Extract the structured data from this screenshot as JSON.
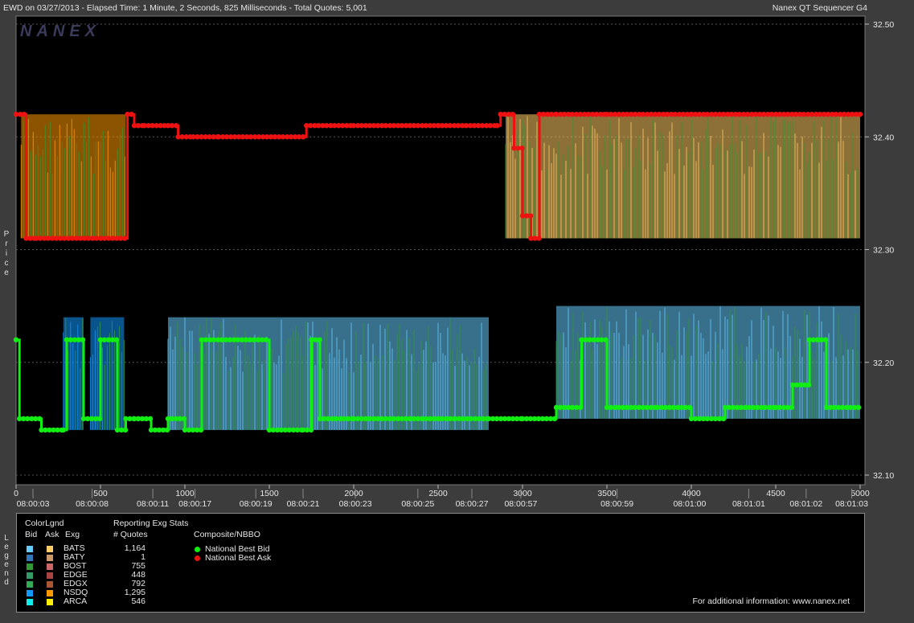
{
  "header": {
    "left": "EWD on 03/27/2013  -  Elapsed Time: 1 Minute, 2 Seconds, 825 Milliseconds  -  Total Quotes: 5,001",
    "right": "Nanex QT Sequencer G4"
  },
  "watermark": "NANEX",
  "side_labels": {
    "price": "Price",
    "legend": "Legend"
  },
  "colors": {
    "background": "#000000",
    "nbbo_bid": "#11ee11",
    "nbbo_ask": "#ee1111",
    "bats_bid": "#66ccff",
    "bats_ask": "#ffcc66",
    "nsdq_bid": "#1199ff",
    "nsdq_ask": "#ff9900",
    "arca_bid": "#11eeee",
    "arca_ask": "#ffee00",
    "boost_bid": "#339933",
    "boost_ask": "#cc6666"
  },
  "chart_data": {
    "type": "line",
    "title": "EWD on 03/27/2013",
    "xlabel": "",
    "ylabel": "Price",
    "xlim": [
      0,
      5000
    ],
    "ylim": [
      32.09,
      32.5
    ],
    "yticks": [
      "32.50",
      "32.40",
      "32.30",
      "32.20",
      "32.10"
    ],
    "xticks": [
      {
        "value": 0,
        "label": "0"
      },
      {
        "value": 500,
        "label": "500"
      },
      {
        "value": 1000,
        "label": "1000"
      },
      {
        "value": 1500,
        "label": "1500"
      },
      {
        "value": 2000,
        "label": "2000"
      },
      {
        "value": 2500,
        "label": "2500"
      },
      {
        "value": 3000,
        "label": "3000"
      },
      {
        "value": 3500,
        "label": "3500"
      },
      {
        "value": 4000,
        "label": "4000"
      },
      {
        "value": 4500,
        "label": "4500"
      },
      {
        "value": 5000,
        "label": "5000"
      }
    ],
    "time_labels": [
      {
        "value": 100,
        "label": "08:00:03"
      },
      {
        "value": 450,
        "label": "08:00:08"
      },
      {
        "value": 810,
        "label": "08:00:11"
      },
      {
        "value": 1060,
        "label": "08:00:17"
      },
      {
        "value": 1420,
        "label": "08:00:19"
      },
      {
        "value": 1700,
        "label": "08:00:21"
      },
      {
        "value": 2010,
        "label": "08:00:23"
      },
      {
        "value": 2380,
        "label": "08:00:25"
      },
      {
        "value": 2700,
        "label": "08:00:27"
      },
      {
        "value": 2990,
        "label": "08:00:57"
      },
      {
        "value": 3560,
        "label": "08:00:59"
      },
      {
        "value": 3990,
        "label": "08:01:00"
      },
      {
        "value": 4340,
        "label": "08:01:01"
      },
      {
        "value": 4680,
        "label": "08:01:02"
      },
      {
        "value": 4950,
        "label": "08:01:03"
      }
    ],
    "series": [
      {
        "name": "National Best Ask",
        "x": [
          0,
          60,
          120,
          660,
          700,
          760,
          900,
          960,
          1050,
          1200,
          1700,
          1720,
          2000,
          2500,
          2850,
          2870,
          2950,
          3000,
          3050,
          3100,
          3200,
          3500,
          4000,
          4500,
          5000
        ],
        "y": [
          32.42,
          32.31,
          32.31,
          32.42,
          32.41,
          32.41,
          32.41,
          32.4,
          32.4,
          32.4,
          32.4,
          32.41,
          32.41,
          32.41,
          32.41,
          32.42,
          32.39,
          32.33,
          32.31,
          32.42,
          32.42,
          32.42,
          32.42,
          32.42,
          32.42
        ]
      },
      {
        "name": "National Best Bid",
        "x": [
          0,
          20,
          150,
          280,
          300,
          400,
          500,
          600,
          650,
          700,
          800,
          900,
          1000,
          1100,
          1500,
          1700,
          1750,
          1800,
          2000,
          2500,
          2600,
          2800,
          3000,
          3200,
          3350,
          3500,
          3800,
          4000,
          4200,
          4500,
          4600,
          4700,
          4800,
          5000
        ],
        "y": [
          32.22,
          32.15,
          32.14,
          32.14,
          32.22,
          32.15,
          32.22,
          32.14,
          32.15,
          32.15,
          32.14,
          32.15,
          32.14,
          32.22,
          32.14,
          32.14,
          32.22,
          32.15,
          32.15,
          32.15,
          32.15,
          32.15,
          32.15,
          32.16,
          32.22,
          32.16,
          32.16,
          32.15,
          32.16,
          32.16,
          32.18,
          32.22,
          32.16,
          32.16
        ]
      }
    ],
    "exchange_regions": [
      {
        "exchange": "NSDQ",
        "side": "ask",
        "x0": 30,
        "x1": 650,
        "low": 32.31,
        "high": 32.42
      },
      {
        "exchange": "NSDQ",
        "side": "bid",
        "x0": 280,
        "x1": 400,
        "low": 32.14,
        "high": 32.24
      },
      {
        "exchange": "NSDQ",
        "side": "bid",
        "x0": 440,
        "x1": 640,
        "low": 32.14,
        "high": 32.24
      },
      {
        "exchange": "BATS",
        "side": "ask",
        "x0": 2900,
        "x1": 5000,
        "low": 32.31,
        "high": 32.42
      },
      {
        "exchange": "BATS",
        "side": "bid",
        "x0": 900,
        "x1": 2800,
        "low": 32.14,
        "high": 32.24
      },
      {
        "exchange": "BATS",
        "side": "bid",
        "x0": 3200,
        "x1": 5000,
        "low": 32.15,
        "high": 32.25
      }
    ]
  },
  "legend": {
    "colorlgnd": "ColorLgnd",
    "col_bid": "Bid",
    "col_ask": "Ask",
    "col_exg": "Exg",
    "reporting": "Reporting Exg Stats",
    "quotes_header": "# Quotes",
    "composite": "Composite/NBBO",
    "nbb": "National Best Bid",
    "nbo": "National Best Ask",
    "info": "For additional information: www.nanex.net",
    "exchanges": [
      {
        "name": "BATS",
        "quotes": "1,164",
        "bid_color": "#66ccff",
        "ask_color": "#ffcc66"
      },
      {
        "name": "BATY",
        "quotes": "1",
        "bid_color": "#3377bb",
        "ask_color": "#cc9966"
      },
      {
        "name": "BOST",
        "quotes": "755",
        "bid_color": "#339933",
        "ask_color": "#cc6666"
      },
      {
        "name": "EDGE",
        "quotes": "448",
        "bid_color": "#339966",
        "ask_color": "#aa4444"
      },
      {
        "name": "EDGX",
        "quotes": "792",
        "bid_color": "#33aa55",
        "ask_color": "#aa5533"
      },
      {
        "name": "NSDQ",
        "quotes": "1,295",
        "bid_color": "#1199ff",
        "ask_color": "#ff9900"
      },
      {
        "name": "ARCA",
        "quotes": "546",
        "bid_color": "#11eeee",
        "ask_color": "#ffee00"
      }
    ]
  }
}
